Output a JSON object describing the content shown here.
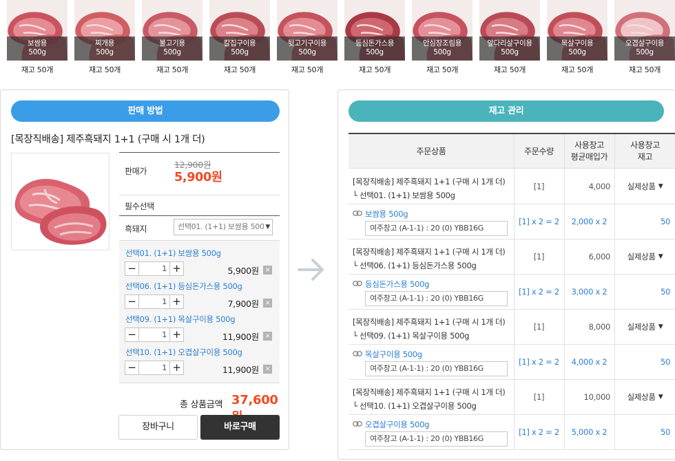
{
  "products": [
    {
      "name": "보쌈용",
      "weight": "500g",
      "stock": "재고 50개"
    },
    {
      "name": "찌개용",
      "weight": "500g",
      "stock": "재고 50개"
    },
    {
      "name": "불고기용",
      "weight": "500g",
      "stock": "재고 50개"
    },
    {
      "name": "칼집구이용",
      "weight": "500g",
      "stock": "재고 50개"
    },
    {
      "name": "뒷고기구이용",
      "weight": "500g",
      "stock": "재고 50개"
    },
    {
      "name": "등심돈가스용",
      "weight": "500g",
      "stock": "재고 50개"
    },
    {
      "name": "안심장조림용",
      "weight": "500g",
      "stock": "재고 50개"
    },
    {
      "name": "앞다리살구이용",
      "weight": "500g",
      "stock": "재고 50개"
    },
    {
      "name": "목살구이용",
      "weight": "500g",
      "stock": "재고 50개"
    },
    {
      "name": "오겹살구이용",
      "weight": "500g",
      "stock": "재고 50개"
    }
  ],
  "sales": {
    "header": "판매 방법",
    "title": "[목장직배송] 제주흑돼지 1+1 (구매 시 1개 더)",
    "price_label": "판매가",
    "original_price": "12,900원",
    "sale_price": "5,900원",
    "required_label": "필수선택",
    "option_label": "흑돼지",
    "option_value": "선택01. (1+1) 보쌈용 500g",
    "selections": [
      {
        "name": "선택01. (1+1) 보쌈용 500g",
        "qty": "1",
        "price": "5,900원"
      },
      {
        "name": "선택06. (1+1) 등심돈가스용 500g",
        "qty": "1",
        "price": "7,900원"
      },
      {
        "name": "선택09. (1+1) 목살구이용 500g",
        "qty": "1",
        "price": "11,900원"
      },
      {
        "name": "선택10. (1+1) 오겹살구이용 500g",
        "qty": "1",
        "price": "11,900원"
      }
    ],
    "total_label": "총 상품금액",
    "total_value": "37,600원",
    "cart_label": "장바구니",
    "buy_label": "바로구매"
  },
  "inventory": {
    "header": "재고 관리",
    "columns": [
      "주문상품",
      "주문수량",
      "사용창고\n평균매입가",
      "사용창고\n재고"
    ],
    "col_order_product": "주문상품",
    "col_qty": "주문수량",
    "col_avg_price_1": "사용창고",
    "col_avg_price_2": "평균매입가",
    "col_stock_1": "사용창고",
    "col_stock_2": "재고",
    "orders": [
      {
        "line1": "[목장직배송] 제주흑돼지 1+1 (구매 시 1개 더)",
        "line2": "└ 선택01. (1+1) 보쌈용 500g",
        "qty": "[1]",
        "avg_price": "4,000",
        "type": "실제상품",
        "sub_name": "보쌈용 500g",
        "warehouse": "여주창고 (A-1-1) : 20 (0) YBB16G",
        "sub_qty": "[1] x 2 = 2",
        "sub_price": "2,000 x 2",
        "sub_stock": "50"
      },
      {
        "line1": "[목장직배송] 제주흑돼지 1+1 (구매 시 1개 더)",
        "line2": "└ 선택06. (1+1) 등심돈가스용 500g",
        "qty": "[1]",
        "avg_price": "6,000",
        "type": "실제상품",
        "sub_name": "등심돈가스용 500g",
        "warehouse": "여주창고 (A-1-1) : 20 (0) YBB16G",
        "sub_qty": "[1] x 2 = 2",
        "sub_price": "3,000 x 2",
        "sub_stock": "50"
      },
      {
        "line1": "[목장직배송] 제주흑돼지 1+1 (구매 시 1개 더)",
        "line2": "└ 선택09. (1+1) 목살구이용 500g",
        "qty": "[1]",
        "avg_price": "8,000",
        "type": "실제상품",
        "sub_name": "목살구이용 500g",
        "warehouse": "여주창고 (A-1-1) : 20 (0) YBB16G",
        "sub_qty": "[1] x 2 = 2",
        "sub_price": "4,000 x 2",
        "sub_stock": "50"
      },
      {
        "line1": "[목장직배송] 제주흑돼지 1+1 (구매 시 1개 더)",
        "line2": "└ 선택10. (1+1) 오겹살구이용 500g",
        "qty": "[1]",
        "avg_price": "10,000",
        "type": "실제상품",
        "sub_name": "오겹살구이용 500g",
        "warehouse": "여주창고 (A-1-1) : 20 (0) YBB16G",
        "sub_qty": "[1] x 2 = 2",
        "sub_price": "5,000 x 2",
        "sub_stock": "50"
      }
    ]
  },
  "colors": {
    "accent_blue": "#3b9ce8",
    "accent_teal": "#4ab3bb",
    "price_red": "#f04a23",
    "link_blue": "#2a7ed3"
  }
}
